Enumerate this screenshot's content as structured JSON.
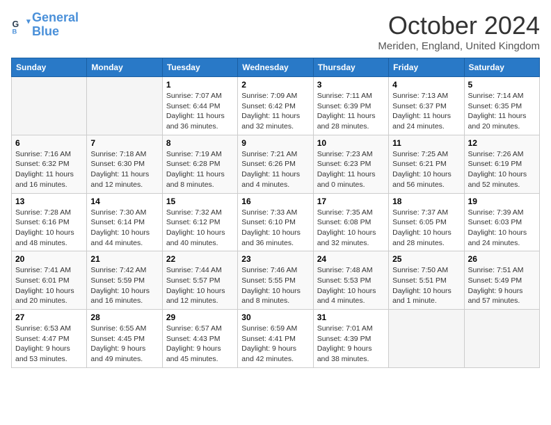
{
  "logo": {
    "line1": "General",
    "line2": "Blue"
  },
  "title": "October 2024",
  "location": "Meriden, England, United Kingdom",
  "weekdays": [
    "Sunday",
    "Monday",
    "Tuesday",
    "Wednesday",
    "Thursday",
    "Friday",
    "Saturday"
  ],
  "weeks": [
    [
      {
        "day": "",
        "detail": ""
      },
      {
        "day": "",
        "detail": ""
      },
      {
        "day": "1",
        "detail": "Sunrise: 7:07 AM\nSunset: 6:44 PM\nDaylight: 11 hours and 36 minutes."
      },
      {
        "day": "2",
        "detail": "Sunrise: 7:09 AM\nSunset: 6:42 PM\nDaylight: 11 hours and 32 minutes."
      },
      {
        "day": "3",
        "detail": "Sunrise: 7:11 AM\nSunset: 6:39 PM\nDaylight: 11 hours and 28 minutes."
      },
      {
        "day": "4",
        "detail": "Sunrise: 7:13 AM\nSunset: 6:37 PM\nDaylight: 11 hours and 24 minutes."
      },
      {
        "day": "5",
        "detail": "Sunrise: 7:14 AM\nSunset: 6:35 PM\nDaylight: 11 hours and 20 minutes."
      }
    ],
    [
      {
        "day": "6",
        "detail": "Sunrise: 7:16 AM\nSunset: 6:32 PM\nDaylight: 11 hours and 16 minutes."
      },
      {
        "day": "7",
        "detail": "Sunrise: 7:18 AM\nSunset: 6:30 PM\nDaylight: 11 hours and 12 minutes."
      },
      {
        "day": "8",
        "detail": "Sunrise: 7:19 AM\nSunset: 6:28 PM\nDaylight: 11 hours and 8 minutes."
      },
      {
        "day": "9",
        "detail": "Sunrise: 7:21 AM\nSunset: 6:26 PM\nDaylight: 11 hours and 4 minutes."
      },
      {
        "day": "10",
        "detail": "Sunrise: 7:23 AM\nSunset: 6:23 PM\nDaylight: 11 hours and 0 minutes."
      },
      {
        "day": "11",
        "detail": "Sunrise: 7:25 AM\nSunset: 6:21 PM\nDaylight: 10 hours and 56 minutes."
      },
      {
        "day": "12",
        "detail": "Sunrise: 7:26 AM\nSunset: 6:19 PM\nDaylight: 10 hours and 52 minutes."
      }
    ],
    [
      {
        "day": "13",
        "detail": "Sunrise: 7:28 AM\nSunset: 6:16 PM\nDaylight: 10 hours and 48 minutes."
      },
      {
        "day": "14",
        "detail": "Sunrise: 7:30 AM\nSunset: 6:14 PM\nDaylight: 10 hours and 44 minutes."
      },
      {
        "day": "15",
        "detail": "Sunrise: 7:32 AM\nSunset: 6:12 PM\nDaylight: 10 hours and 40 minutes."
      },
      {
        "day": "16",
        "detail": "Sunrise: 7:33 AM\nSunset: 6:10 PM\nDaylight: 10 hours and 36 minutes."
      },
      {
        "day": "17",
        "detail": "Sunrise: 7:35 AM\nSunset: 6:08 PM\nDaylight: 10 hours and 32 minutes."
      },
      {
        "day": "18",
        "detail": "Sunrise: 7:37 AM\nSunset: 6:05 PM\nDaylight: 10 hours and 28 minutes."
      },
      {
        "day": "19",
        "detail": "Sunrise: 7:39 AM\nSunset: 6:03 PM\nDaylight: 10 hours and 24 minutes."
      }
    ],
    [
      {
        "day": "20",
        "detail": "Sunrise: 7:41 AM\nSunset: 6:01 PM\nDaylight: 10 hours and 20 minutes."
      },
      {
        "day": "21",
        "detail": "Sunrise: 7:42 AM\nSunset: 5:59 PM\nDaylight: 10 hours and 16 minutes."
      },
      {
        "day": "22",
        "detail": "Sunrise: 7:44 AM\nSunset: 5:57 PM\nDaylight: 10 hours and 12 minutes."
      },
      {
        "day": "23",
        "detail": "Sunrise: 7:46 AM\nSunset: 5:55 PM\nDaylight: 10 hours and 8 minutes."
      },
      {
        "day": "24",
        "detail": "Sunrise: 7:48 AM\nSunset: 5:53 PM\nDaylight: 10 hours and 4 minutes."
      },
      {
        "day": "25",
        "detail": "Sunrise: 7:50 AM\nSunset: 5:51 PM\nDaylight: 10 hours and 1 minute."
      },
      {
        "day": "26",
        "detail": "Sunrise: 7:51 AM\nSunset: 5:49 PM\nDaylight: 9 hours and 57 minutes."
      }
    ],
    [
      {
        "day": "27",
        "detail": "Sunrise: 6:53 AM\nSunset: 4:47 PM\nDaylight: 9 hours and 53 minutes."
      },
      {
        "day": "28",
        "detail": "Sunrise: 6:55 AM\nSunset: 4:45 PM\nDaylight: 9 hours and 49 minutes."
      },
      {
        "day": "29",
        "detail": "Sunrise: 6:57 AM\nSunset: 4:43 PM\nDaylight: 9 hours and 45 minutes."
      },
      {
        "day": "30",
        "detail": "Sunrise: 6:59 AM\nSunset: 4:41 PM\nDaylight: 9 hours and 42 minutes."
      },
      {
        "day": "31",
        "detail": "Sunrise: 7:01 AM\nSunset: 4:39 PM\nDaylight: 9 hours and 38 minutes."
      },
      {
        "day": "",
        "detail": ""
      },
      {
        "day": "",
        "detail": ""
      }
    ]
  ]
}
